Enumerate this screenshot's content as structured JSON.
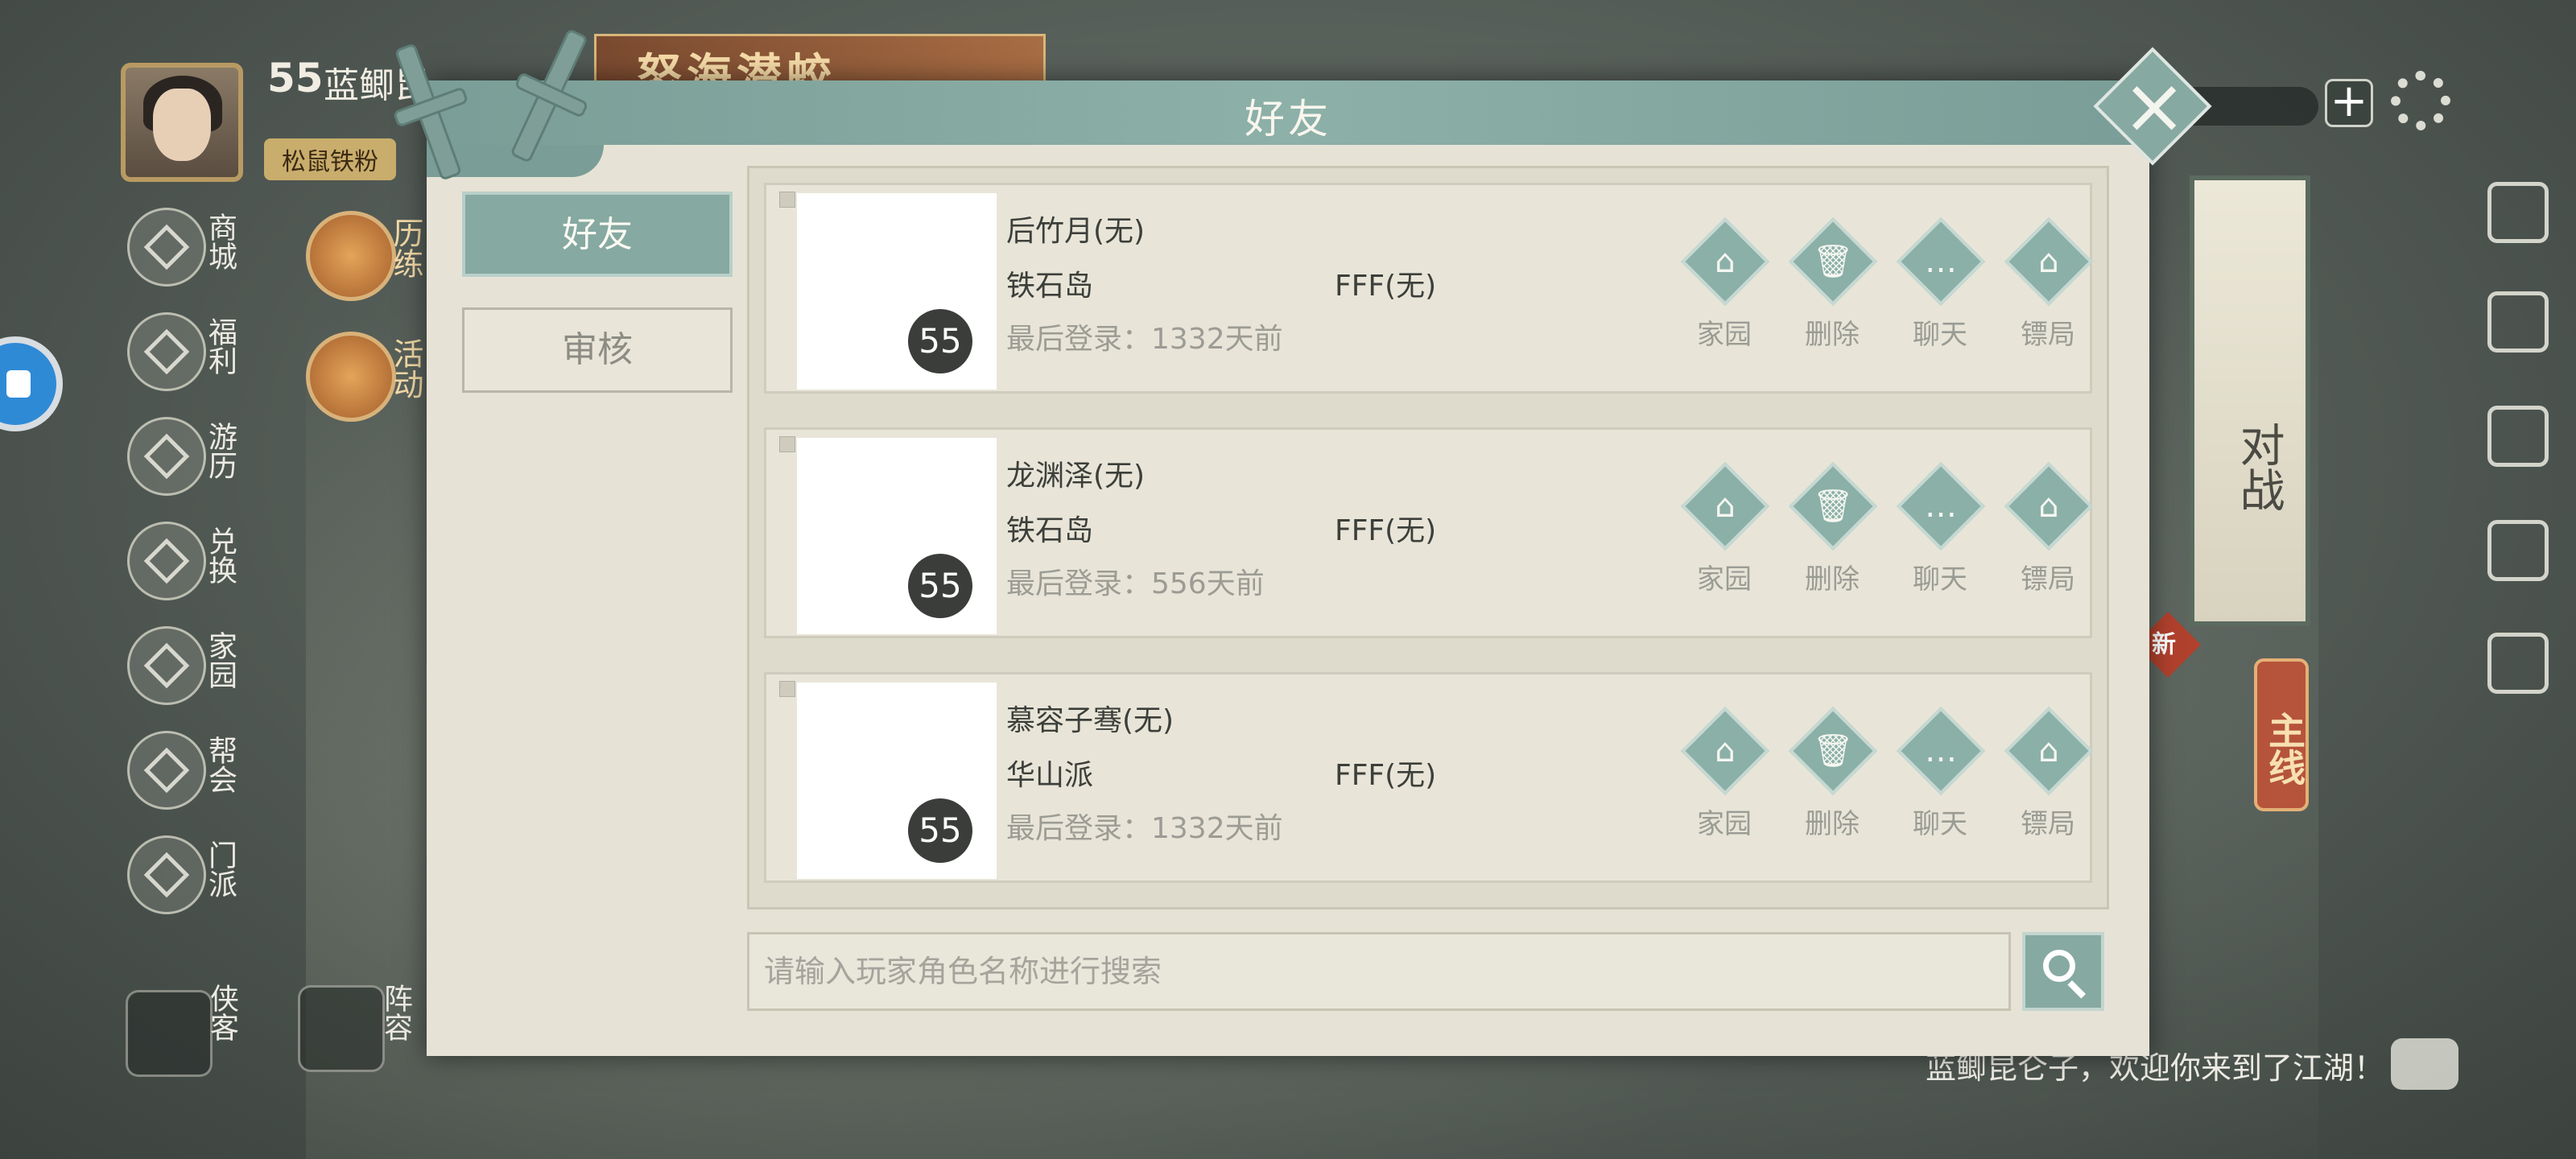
{
  "hud": {
    "player": {
      "level": "55",
      "name": "蓝鲫昆",
      "title": "松鼠铁粉"
    },
    "banner_text": "怒海潜蛟",
    "left_menu": [
      {
        "label": "商城",
        "icon": "shop-icon"
      },
      {
        "label": "福利",
        "icon": "gift-icon"
      },
      {
        "label": "游历",
        "icon": "horse-icon"
      },
      {
        "label": "兑换",
        "icon": "exchange-icon"
      },
      {
        "label": "家园",
        "icon": "home-icon"
      },
      {
        "label": "帮会",
        "icon": "guild-icon"
      },
      {
        "label": "门派",
        "icon": "sect-icon"
      }
    ],
    "activities": [
      {
        "label": "历练",
        "icon": "lotus-icon"
      },
      {
        "label": "活动",
        "icon": "activity-icon"
      }
    ],
    "bottom_buttons": [
      {
        "label": "侠客",
        "icon": "hero-icon"
      },
      {
        "label": "阵容",
        "icon": "lineup-icon"
      }
    ],
    "battle_scroll_label": "对战",
    "new_badge": "新",
    "main_quest_label": "主线",
    "welcome_text": "蓝鲫昆仑子，欢迎你来到了江湖！"
  },
  "dialog": {
    "title": "好友",
    "tabs": [
      {
        "label": "好友",
        "active": true
      },
      {
        "label": "审核",
        "active": false
      }
    ],
    "friends": [
      {
        "name": "后竹月(无)",
        "sect": "铁石岛",
        "guild": "FFF(无)",
        "level": "55",
        "last_login": "最后登录：1332天前"
      },
      {
        "name": "龙渊泽(无)",
        "sect": "铁石岛",
        "guild": "FFF(无)",
        "level": "55",
        "last_login": "最后登录：556天前"
      },
      {
        "name": "慕容子骞(无)",
        "sect": "华山派",
        "guild": "FFF(无)",
        "level": "55",
        "last_login": "最后登录：1332天前"
      }
    ],
    "actions": [
      {
        "label": "家园",
        "icon": "home-icon"
      },
      {
        "label": "删除",
        "icon": "trash-icon"
      },
      {
        "label": "聊天",
        "icon": "chat-icon"
      },
      {
        "label": "镖局",
        "icon": "escort-icon"
      }
    ],
    "search": {
      "placeholder": "请输入玩家角色名称进行搜索",
      "value": ""
    }
  },
  "colors": {
    "accent": "#86a9a1",
    "panel": "#e6e3d6",
    "text": "#3c3f3a",
    "muted": "#9c9c94"
  }
}
